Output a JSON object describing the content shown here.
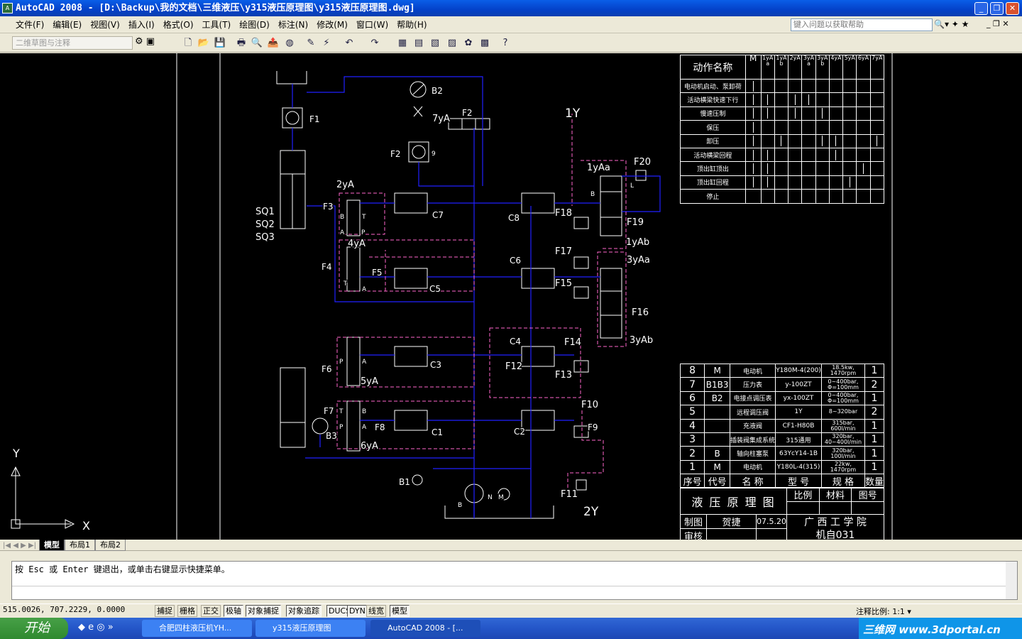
{
  "window": {
    "title": "AutoCAD 2008 - [D:\\Backup\\我的文档\\三维液压\\y315液压原理图\\y315液压原理图.dwg]",
    "app_icon": "autocad-icon"
  },
  "menu": [
    "文件(F)",
    "编辑(E)",
    "视图(V)",
    "插入(I)",
    "格式(O)",
    "工具(T)",
    "绘图(D)",
    "标注(N)",
    "修改(M)",
    "窗口(W)",
    "帮助(H)"
  ],
  "help_placeholder": "键入问题以获取帮助",
  "workspace": "二维草图与注释",
  "toolbar_icons": [
    "new-icon",
    "open-icon",
    "save-icon",
    "plot-icon",
    "plot-preview-icon",
    "publish-icon",
    "3d-dwf-icon",
    "match-properties-icon",
    "block-editor-icon",
    "undo-icon",
    "redo-icon",
    "properties-icon",
    "design-center-icon",
    "tool-palettes-icon",
    "sheet-set-icon",
    "markup-icon",
    "calculator-icon",
    "help-icon"
  ],
  "drawing": {
    "labels": [
      "F1",
      "B2",
      "7yA",
      "F2",
      "1Y",
      "F2",
      "9",
      "2yA",
      "F3",
      "C7",
      "C8",
      "1yAa",
      "F20",
      "F18",
      "F19",
      "1yAb",
      "SQ1",
      "SQ2",
      "SQ3",
      "4yA",
      "F4",
      "F5",
      "C5",
      "C6",
      "F17",
      "3yAa",
      "F15",
      "F16",
      "3yAb",
      "C4",
      "F14",
      "F12",
      "F13",
      "F6",
      "C3",
      "5yA",
      "F7",
      "F8",
      "C1",
      "C2",
      "F10",
      "F9",
      "B3",
      "6yA",
      "B1",
      "N",
      "M",
      "B",
      "F11",
      "2Y",
      "B",
      "T",
      "A",
      "P",
      "T",
      "L",
      "A",
      "B",
      "P",
      "A",
      "T",
      "B",
      "P",
      "A"
    ],
    "ucs": {
      "y": "Y",
      "x": "X"
    },
    "colors": {
      "pressure_line": "#1f1fff",
      "pilot_line": "#ff66cc",
      "component": "#ffffff"
    }
  },
  "action_table": {
    "header_title": "动作名称",
    "columns": [
      "M",
      "1yAa",
      "1yAb",
      "2yA",
      "3yAa",
      "3yAb",
      "4yA",
      "5yA",
      "6yA",
      "7yA"
    ],
    "rows": [
      {
        "name": "电动机启动、泵卸荷",
        "on": [
          0
        ]
      },
      {
        "name": "活动横梁快速下行",
        "on": [
          0,
          1,
          3,
          4
        ]
      },
      {
        "name": "慢速压制",
        "on": [
          0,
          1,
          3,
          5
        ]
      },
      {
        "name": "保压",
        "on": [
          0
        ]
      },
      {
        "name": "卸压",
        "on": [
          0,
          2,
          5,
          6,
          9
        ]
      },
      {
        "name": "活动横梁回程",
        "on": [
          0,
          1,
          6
        ]
      },
      {
        "name": "顶出缸顶出",
        "on": [
          0,
          1,
          8
        ]
      },
      {
        "name": "顶出缸回程",
        "on": [
          0,
          1,
          7
        ]
      },
      {
        "name": "停止",
        "on": []
      }
    ]
  },
  "parts_table": {
    "rows": [
      [
        "8",
        "M",
        "电动机",
        "Y180M-4(200)",
        "18.5kw,\n1470rpm",
        "1"
      ],
      [
        "7",
        "B1B3",
        "压力表",
        "y-100ZT",
        "0~400bar,\nΦ=100mm",
        "2"
      ],
      [
        "6",
        "B2",
        "电接点调压表",
        "yx-100ZT",
        "0~400bar,\nΦ=100mm",
        "1"
      ],
      [
        "5",
        "",
        "远程调压阀",
        "1Y",
        "8~320bar",
        "2"
      ],
      [
        "4",
        "",
        "充液阀",
        "CF1-H80B",
        "315bar,\n600l/min",
        "1"
      ],
      [
        "3",
        "",
        "插装阀集成系统",
        "315通用",
        "320bar,\n40~400l/min",
        "1"
      ],
      [
        "2",
        "B",
        "轴向柱塞泵",
        "63YcY14-1B",
        "320bar,\n100l/min",
        "1"
      ],
      [
        "1",
        "M",
        "电动机",
        "Y180L-4(315)",
        "22kw,\n1470rpm",
        "1"
      ]
    ],
    "header": [
      "序号",
      "代号",
      "名 称",
      "型 号",
      "规 格",
      "数量"
    ]
  },
  "title_block": {
    "title": "液 压 原 理 图",
    "scale": "比例",
    "material": "材料",
    "drawing_no": "图号",
    "drawn_label": "制图",
    "drawn_by": "贺捷",
    "date": "07.5.20",
    "checked_label": "审核",
    "school": "广 西 工 学 院",
    "class": "机自031"
  },
  "layout_tabs": [
    "模型",
    "布局1",
    "布局2"
  ],
  "command": {
    "line1": "按 Esc 或 Enter 键退出，或单击右键显示快捷菜单。"
  },
  "status": {
    "coords": "515.0026, 707.2229, 0.0000",
    "buttons": [
      {
        "label": "捕捉",
        "on": false
      },
      {
        "label": "栅格",
        "on": false
      },
      {
        "label": "正交",
        "on": false
      },
      {
        "label": "极轴",
        "on": true
      },
      {
        "label": "对象捕捉",
        "on": true
      },
      {
        "label": "对象追踪",
        "on": true
      },
      {
        "label": "DUCS",
        "on": true
      },
      {
        "label": "DYN",
        "on": true
      },
      {
        "label": "线宽",
        "on": false
      },
      {
        "label": "模型",
        "on": true
      }
    ],
    "annotation_scale": "注释比例: 1:1 ▾"
  },
  "taskbar": {
    "start": "开始",
    "tasks": [
      "合肥四柱液压机YH...",
      "y315液压原理图",
      "AutoCAD 2008 - [..."
    ],
    "watermark": "三维网 www.3dportal.cn"
  }
}
